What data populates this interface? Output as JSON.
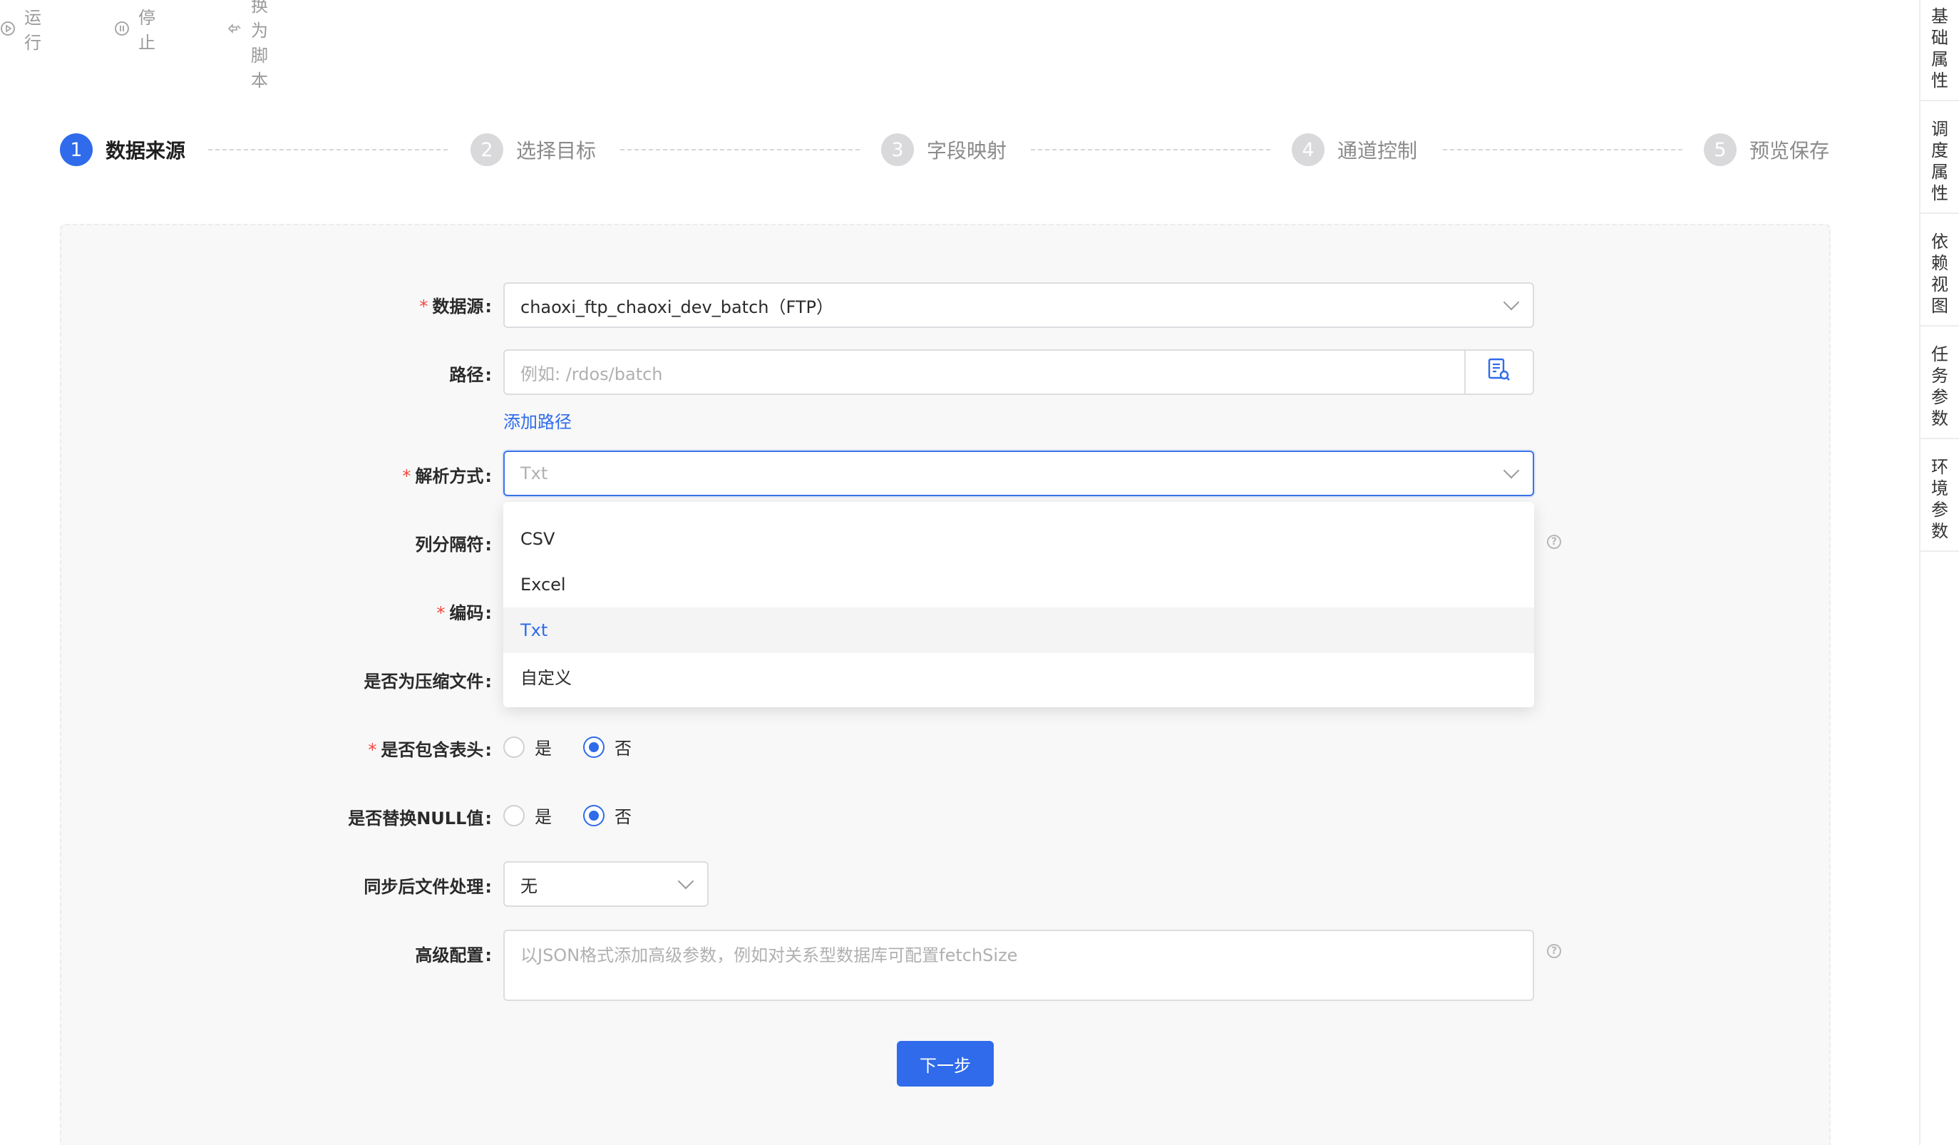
{
  "toolbar": {
    "run": "运行",
    "stop": "停止",
    "convert": "转换为脚本"
  },
  "steps": [
    {
      "num": "1",
      "label": "数据来源"
    },
    {
      "num": "2",
      "label": "选择目标"
    },
    {
      "num": "3",
      "label": "字段映射"
    },
    {
      "num": "4",
      "label": "通道控制"
    },
    {
      "num": "5",
      "label": "预览保存"
    }
  ],
  "form": {
    "datasource": {
      "label": "数据源",
      "value": "chaoxi_ftp_chaoxi_dev_batch（FTP）"
    },
    "path": {
      "label": "路径",
      "placeholder": "例如: /rdos/batch",
      "add_link": "添加路径"
    },
    "parse": {
      "label": "解析方式",
      "placeholder": "Txt"
    },
    "delimiter": {
      "label": "列分隔符"
    },
    "encoding": {
      "label": "编码"
    },
    "compressed": {
      "label": "是否为压缩文件"
    },
    "header": {
      "label": "是否包含表头",
      "yes": "是",
      "no": "否"
    },
    "replace_null": {
      "label": "是否替换NULL值",
      "yes": "是",
      "no": "否"
    },
    "post_process": {
      "label": "同步后文件处理",
      "value": "无"
    },
    "advanced": {
      "label": "高级配置",
      "placeholder": "以JSON格式添加高级参数，例如对关系型数据库可配置fetchSize"
    },
    "next": "下一步"
  },
  "dropdown": {
    "options": [
      "CSV",
      "Excel",
      "Txt",
      "自定义"
    ],
    "selected": "Txt"
  },
  "side_tabs": [
    "基础属性",
    "调度属性",
    "依赖视图",
    "任务参数",
    "环境参数"
  ],
  "colors": {
    "primary": "#2f6bea",
    "required": "#f5463b"
  }
}
